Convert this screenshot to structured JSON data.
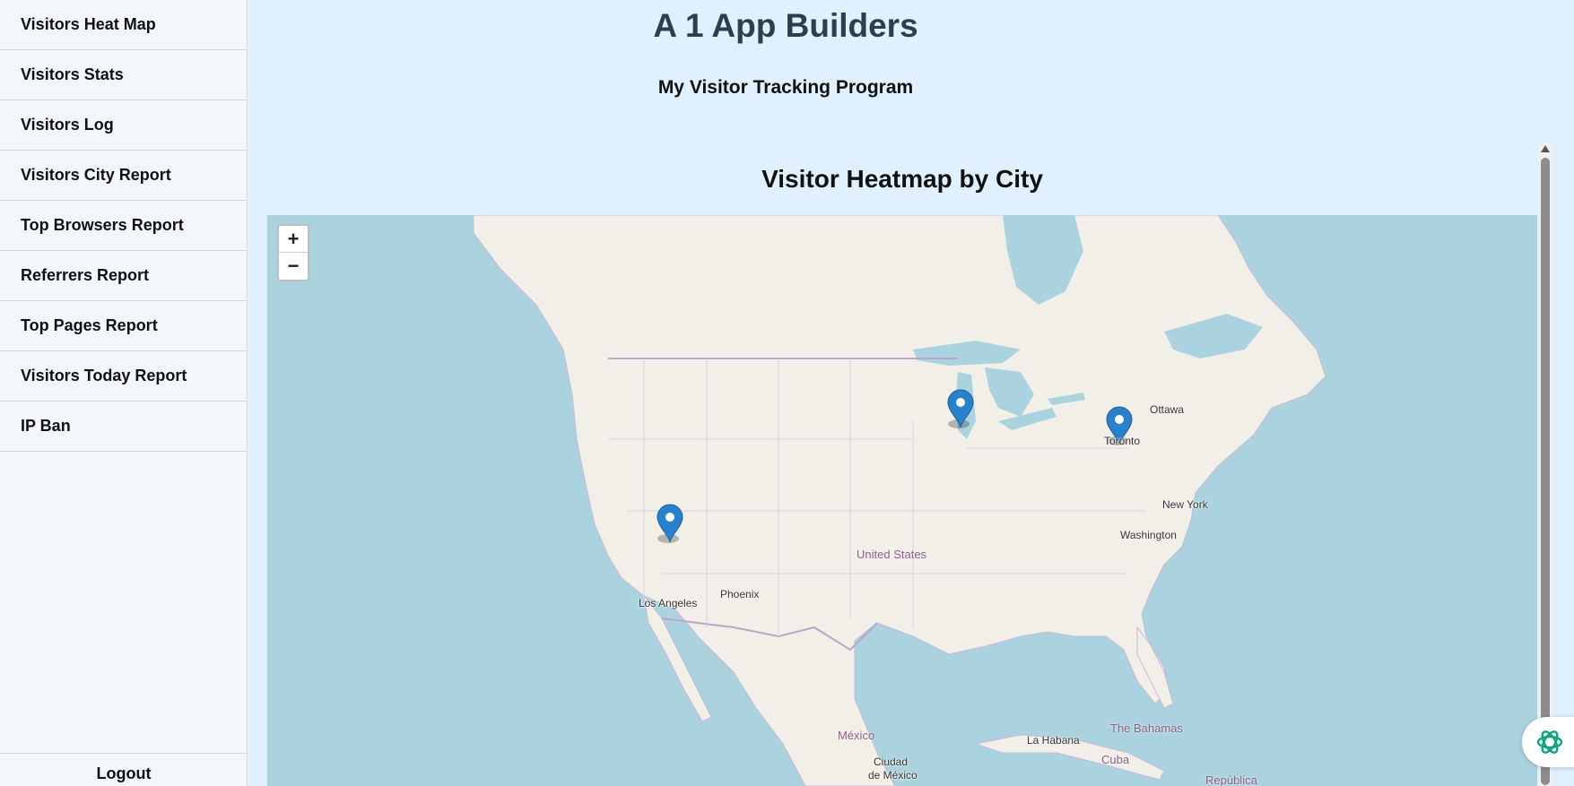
{
  "sidebar": {
    "items": [
      {
        "label": "Visitors Heat Map"
      },
      {
        "label": "Visitors Stats"
      },
      {
        "label": "Visitors Log"
      },
      {
        "label": "Visitors City Report"
      },
      {
        "label": "Top Browsers Report"
      },
      {
        "label": "Referrers Report"
      },
      {
        "label": "Top Pages Report"
      },
      {
        "label": "Visitors Today Report"
      },
      {
        "label": "IP Ban"
      }
    ],
    "logout_label": "Logout"
  },
  "header": {
    "title": "A 1 App Builders",
    "subtitle": "My Visitor Tracking Program"
  },
  "map": {
    "title": "Visitor Heatmap by City",
    "zoom_in": "+",
    "zoom_out": "−",
    "labels": {
      "ottawa": "Ottawa",
      "toronto": "Toronto",
      "new_york": "New York",
      "washington": "Washington",
      "united_states": "United States",
      "phoenix": "Phoenix",
      "los_angeles": "Los Angeles",
      "mexico": "México",
      "ciudad_de_mexico_1": "Ciudad",
      "ciudad_de_mexico_2": "de México",
      "la_habana": "La Habana",
      "the_bahamas": "The Bahamas",
      "cuba": "Cuba",
      "republica": "República"
    },
    "markers": [
      "Chicago",
      "New York",
      "Los Angeles"
    ],
    "colors": {
      "water": "#aad3df",
      "land": "#f2efe9",
      "marker": "#2a81cb"
    }
  }
}
